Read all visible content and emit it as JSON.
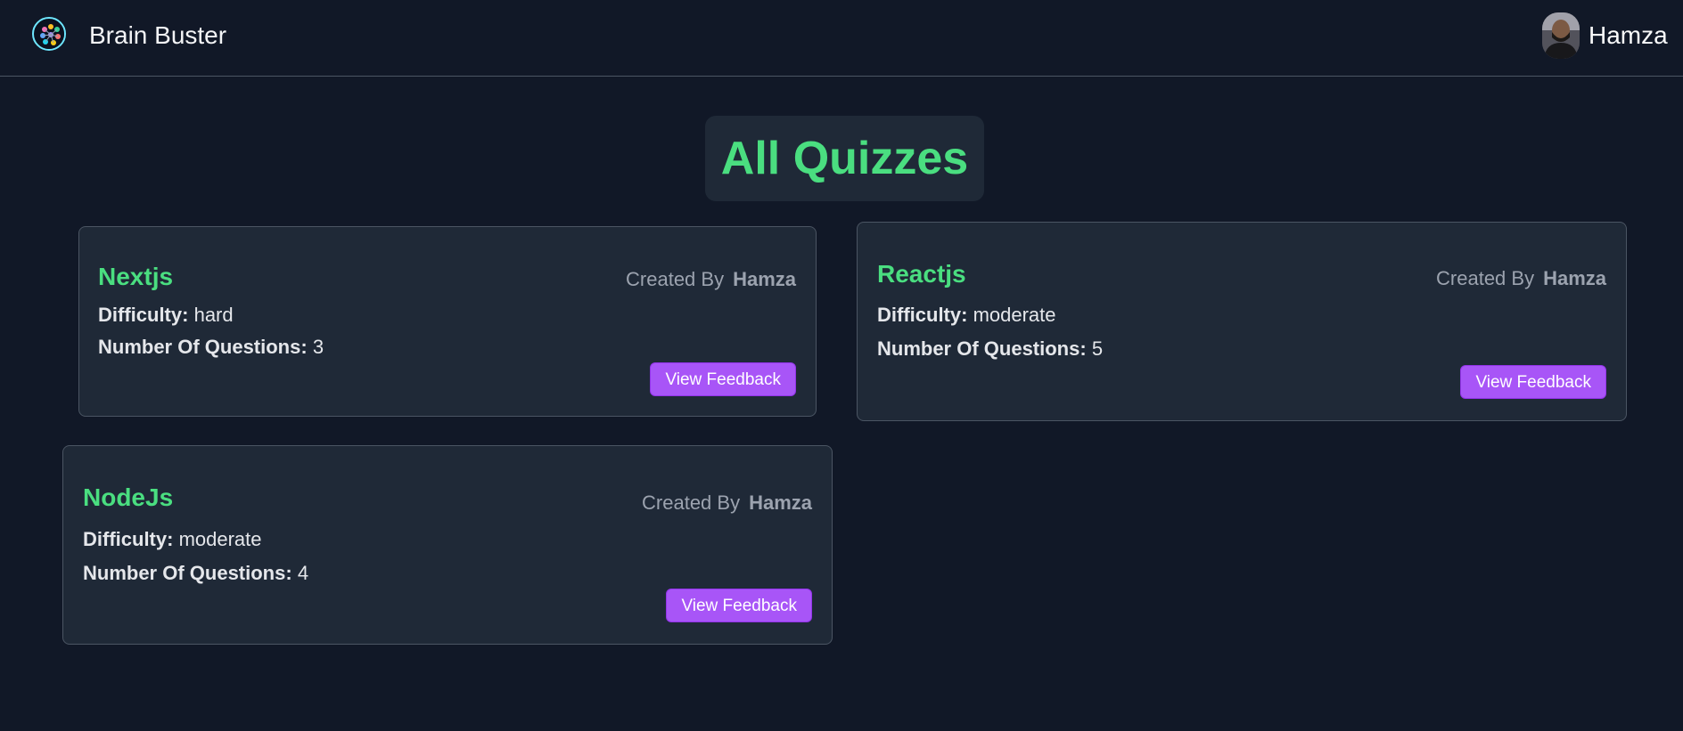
{
  "navbar": {
    "brand": "Brain Buster",
    "username": "Hamza",
    "logo_icon": "brain-icon",
    "avatar_icon": "user-avatar"
  },
  "main": {
    "title": "All Quizzes"
  },
  "quizzes": [
    {
      "name": "Nextjs",
      "created_by_label": "Created By",
      "author": "Hamza",
      "difficulty_label": "Difficulty:",
      "difficulty": "hard",
      "questions_label": "Number Of Questions:",
      "questions": "3",
      "button_label": "View Feedback"
    },
    {
      "name": "Reactjs",
      "created_by_label": "Created By",
      "author": "Hamza",
      "difficulty_label": "Difficulty:",
      "difficulty": "moderate",
      "questions_label": "Number Of Questions:",
      "questions": "5",
      "button_label": "View Feedback"
    },
    {
      "name": "NodeJs",
      "created_by_label": "Created By",
      "author": "Hamza",
      "difficulty_label": "Difficulty:",
      "difficulty": "moderate",
      "questions_label": "Number Of Questions:",
      "questions": "4",
      "button_label": "View Feedback"
    }
  ],
  "colors": {
    "background": "#111827",
    "card": "#1f2937",
    "accent_green": "#4ade80",
    "button_purple": "#a855f7"
  }
}
